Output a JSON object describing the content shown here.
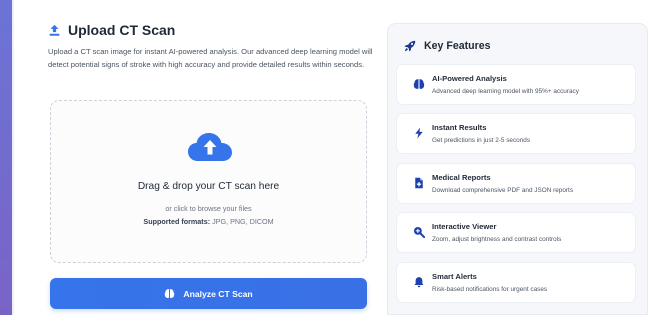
{
  "upload": {
    "title": "Upload CT Scan",
    "title_icon": "upload-icon",
    "description": "Upload a CT scan image for instant AI-powered analysis. Our advanced deep learning model will detect potential signs of stroke with high accuracy and provide detailed results within seconds.",
    "dropzone": {
      "icon": "cloud-upload-icon",
      "title": "Drag & drop your CT scan here",
      "browse_text": "or click to browse your files",
      "formats_label": "Supported formats:",
      "formats_value": "JPG, PNG, DICOM"
    },
    "analyze_button": "Analyze CT Scan",
    "analyze_icon": "brain-icon"
  },
  "features": {
    "title": "Key Features",
    "title_icon": "rocket-icon",
    "items": [
      {
        "icon": "brain-icon",
        "title": "AI-Powered Analysis",
        "desc": "Advanced deep learning model with 95%+ accuracy"
      },
      {
        "icon": "bolt-icon",
        "title": "Instant Results",
        "desc": "Get predictions in just 2-5 seconds"
      },
      {
        "icon": "file-medical-icon",
        "title": "Medical Reports",
        "desc": "Download comprehensive PDF and JSON reports"
      },
      {
        "icon": "search-plus-icon",
        "title": "Interactive Viewer",
        "desc": "Zoom, adjust brightness and contrast controls"
      },
      {
        "icon": "bell-icon",
        "title": "Smart Alerts",
        "desc": "Risk-based notifications for urgent cases"
      }
    ]
  },
  "colors": {
    "accent": "#3574ea",
    "rail": "#6b74d6",
    "text_dark": "#1f2937",
    "panel_bg": "#f5f7fa"
  }
}
